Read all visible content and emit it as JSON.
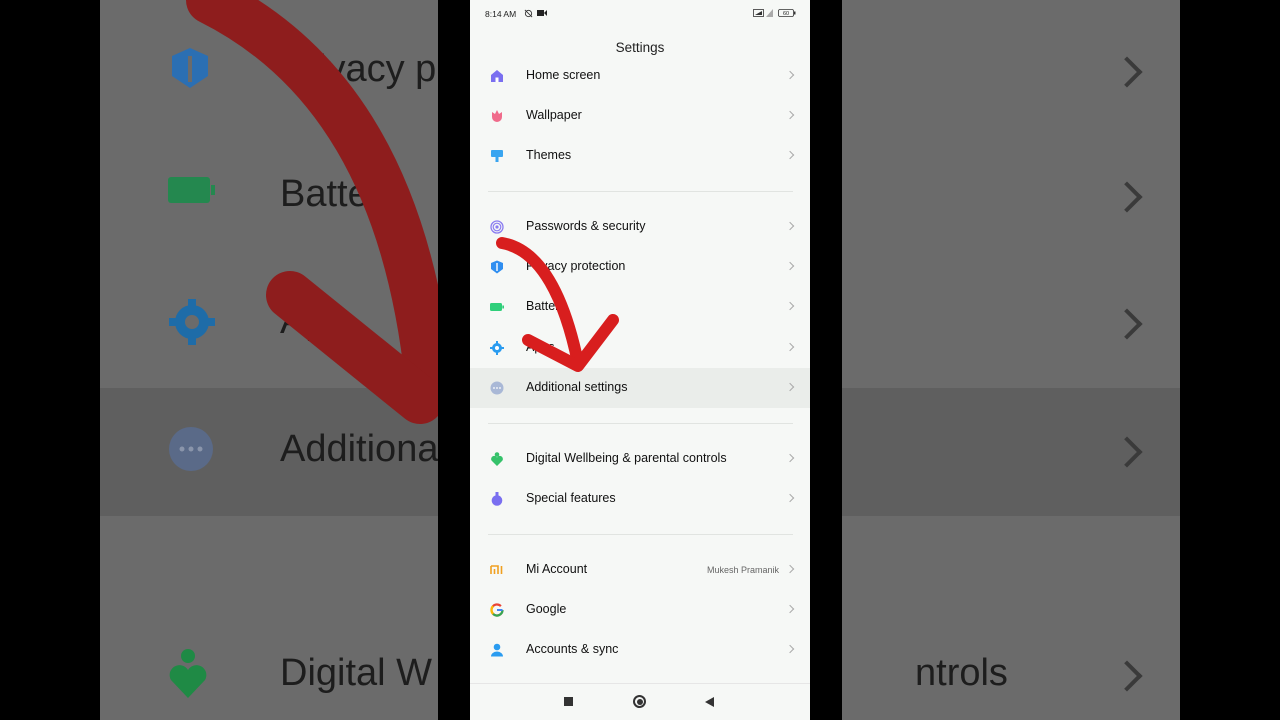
{
  "status_bar": {
    "time": "8:14 AM",
    "battery_level": "60"
  },
  "page_title": "Settings",
  "sections": [
    [
      {
        "name": "home-screen",
        "label": "Home screen",
        "icon": "home-icon",
        "color": "#7a6ff0"
      },
      {
        "name": "wallpaper",
        "label": "Wallpaper",
        "icon": "tulip-icon",
        "color": "#f06b8b"
      },
      {
        "name": "themes",
        "label": "Themes",
        "icon": "paint-brush-icon",
        "color": "#39a5f0"
      }
    ],
    [
      {
        "name": "passwords-security",
        "label": "Passwords & security",
        "icon": "fingerprint-icon",
        "color": "#8a7cf0"
      },
      {
        "name": "privacy-protection",
        "label": "Privacy protection",
        "icon": "shield-icon",
        "color": "#2f8ef0"
      },
      {
        "name": "battery",
        "label": "Battery",
        "icon": "battery-icon",
        "color": "#2fcf7a"
      },
      {
        "name": "apps",
        "label": "Apps",
        "icon": "gear-icon",
        "color": "#2a9cf0"
      },
      {
        "name": "additional-settings",
        "label": "Additional settings",
        "icon": "more-dots-icon",
        "color": "#a9b8d6",
        "highlighted": true
      }
    ],
    [
      {
        "name": "digital-wellbeing",
        "label": "Digital Wellbeing & parental controls",
        "icon": "wellbeing-heart-icon",
        "color": "#35c26a"
      },
      {
        "name": "special-features",
        "label": "Special features",
        "icon": "flask-icon",
        "color": "#7a6ff0"
      }
    ],
    [
      {
        "name": "mi-account",
        "label": "Mi Account",
        "icon": "mi-logo-icon",
        "color": "#f0a020",
        "value": "Mukesh Pramanik"
      },
      {
        "name": "google",
        "label": "Google",
        "icon": "google-g-icon",
        "color": "#4285f4"
      },
      {
        "name": "accounts-sync",
        "label": "Accounts & sync",
        "icon": "person-icon",
        "color": "#2a9cf0"
      }
    ]
  ],
  "nav_bar": {
    "recents": "square-icon",
    "home": "circle-icon",
    "back": "triangle-back-icon"
  },
  "overlay": {
    "arrow_color": "#d81e1e"
  },
  "background": {
    "items": [
      "Privacy protection",
      "Battery",
      "Apps",
      "Additional settings",
      "Digital Wellbeing & parental controls"
    ]
  }
}
